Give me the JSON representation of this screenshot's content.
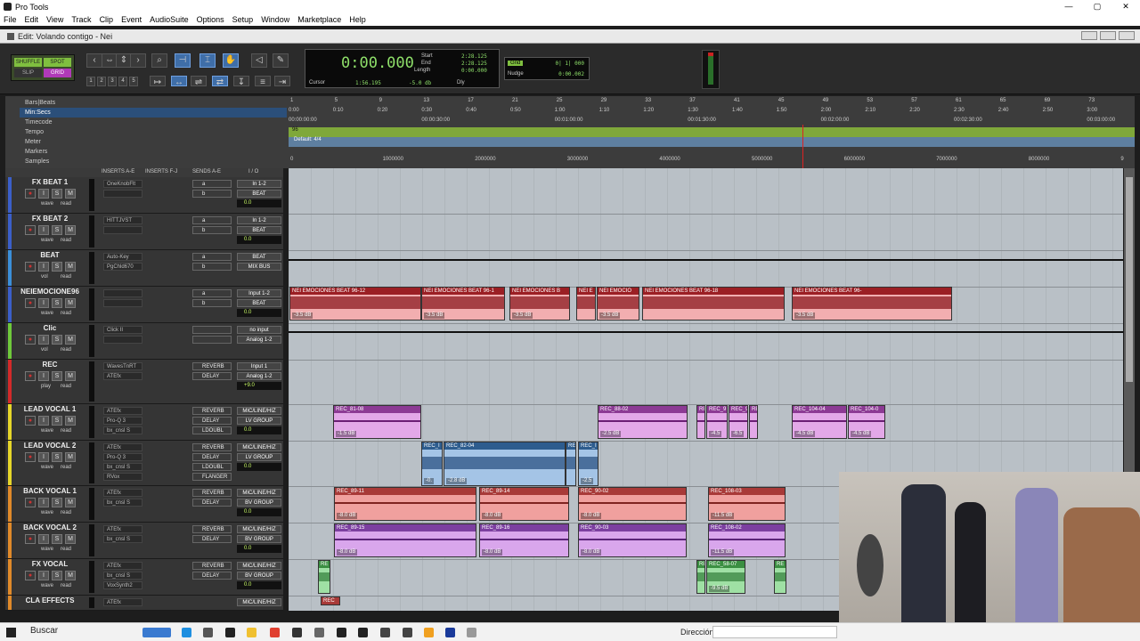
{
  "window": {
    "title": "Pro Tools",
    "minimize": "—",
    "restore": "▢",
    "close": "✕"
  },
  "menu": [
    "File",
    "Edit",
    "View",
    "Track",
    "Clip",
    "Event",
    "AudioSuite",
    "Options",
    "Setup",
    "Window",
    "Marketplace",
    "Help"
  ],
  "edit_window": {
    "title": "Edit: Volando contigo - Nei"
  },
  "modes": {
    "shuffle": "SHUFFLE",
    "spot": "SPOT",
    "slip": "SLIP",
    "grid": "GRID"
  },
  "counter": {
    "main": "0:00.000",
    "start_label": "Start",
    "start": "2:28.125",
    "end_label": "End",
    "end": "2:28.125",
    "length_label": "Length",
    "length": "0:00.000",
    "cursor_label": "Cursor",
    "cursor": "1:56.195",
    "gain": "-5.0 db",
    "dly": "Dly"
  },
  "grid": {
    "label": "Grid",
    "value": "0| 1| 000",
    "nudge_label": "Nudge",
    "nudge_value": "0:00.002"
  },
  "zoom_buttons": [
    "1",
    "2",
    "3",
    "4",
    "5"
  ],
  "rulers": {
    "rows": [
      "Bars|Beats",
      "Min:Secs",
      "Timecode",
      "Tempo",
      "Meter",
      "Markers",
      "Samples"
    ],
    "bars": [
      "1",
      "5",
      "9",
      "13",
      "17",
      "21",
      "25",
      "29",
      "33",
      "37",
      "41",
      "45",
      "49",
      "53",
      "57",
      "61",
      "65",
      "69",
      "73"
    ],
    "minsecs": [
      "0:00",
      "0:10",
      "0:20",
      "0:30",
      "0:40",
      "0:50",
      "1:00",
      "1:10",
      "1:20",
      "1:30",
      "1:40",
      "1:50",
      "2:00",
      "2:10",
      "2:20",
      "2:30",
      "2:40",
      "2:50",
      "3:00"
    ],
    "timecode": [
      "00:00:00:00",
      "00:00:30:00",
      "00:01:00:00",
      "00:01:30:00",
      "00:02:00:00",
      "00:02:30:00",
      "00:03:00:00"
    ],
    "tempo": "96",
    "meter": "Default: 4/4",
    "samples": [
      "0",
      "1000000",
      "2000000",
      "3000000",
      "4000000",
      "5000000",
      "6000000",
      "7000000",
      "8000000",
      "9"
    ]
  },
  "columns": {
    "inserts_ae": "INSERTS A-E",
    "inserts_fj": "INSERTS F-J",
    "sends_ae": "SENDS A-E",
    "io": "I / O"
  },
  "tracks": [
    {
      "name": "FX BEAT 1",
      "color": "#3b5fc9",
      "mode": "wave",
      "auto": "read",
      "inserts": [
        "OneKnobFlt",
        ""
      ],
      "sends": [
        "a",
        "b"
      ],
      "io": [
        "In 1-2",
        "BEAT"
      ],
      "vol": "0.0"
    },
    {
      "name": "FX BEAT 2",
      "color": "#3b5fc9",
      "mode": "wave",
      "auto": "read",
      "inserts": [
        "HITTJVST",
        ""
      ],
      "sends": [
        "a",
        "b"
      ],
      "io": [
        "In 1-2",
        "BEAT"
      ],
      "vol": "0.0"
    },
    {
      "name": "BEAT",
      "color": "#3b8fd9",
      "mode": "vol",
      "auto": "read",
      "inserts": [
        "Auto-Key",
        "PgChld670"
      ],
      "sends": [
        "a",
        "b"
      ],
      "io": [
        "BEAT",
        "MIX BUS"
      ],
      "vol": ""
    },
    {
      "name": "NEIEMOCIONE96",
      "color": "#3b5fc9",
      "mode": "wave",
      "auto": "read",
      "inserts": [
        "",
        ""
      ],
      "sends": [
        "a",
        "b"
      ],
      "io": [
        "Input 1-2",
        "BEAT"
      ],
      "vol": "0.0"
    },
    {
      "name": "Clic",
      "color": "#6fc93b",
      "mode": "vol",
      "auto": "read",
      "inserts": [
        "Click II",
        ""
      ],
      "sends": [
        "",
        ""
      ],
      "io": [
        "no input",
        "Analog 1-2"
      ],
      "vol": ""
    },
    {
      "name": "REC",
      "color": "#d32a2a",
      "mode": "play",
      "auto": "read",
      "inserts": [
        "WavesTnRT",
        "ATEfx"
      ],
      "sends": [
        "REVERB",
        "DELAY"
      ],
      "io": [
        "Input 1",
        "Analog 1-2"
      ],
      "vol": "+9.0"
    },
    {
      "name": "LEAD VOCAL 1",
      "color": "#e6d62a",
      "mode": "wave",
      "auto": "read",
      "inserts": [
        "ATEfx",
        "Pro-Q 3",
        "bx_cnsl S"
      ],
      "sends": [
        "REVERB",
        "DELAY",
        "LDOUBL"
      ],
      "io": [
        "MIC/LINE/HIZ",
        "LV GROUP"
      ],
      "vol": "0.0"
    },
    {
      "name": "LEAD VOCAL 2",
      "color": "#e6d62a",
      "mode": "wave",
      "auto": "read",
      "inserts": [
        "ATEfx",
        "Pro-Q 3",
        "bx_cnsl S",
        "RVox"
      ],
      "sends": [
        "REVERB",
        "DELAY",
        "LDOUBL",
        "FLANGER"
      ],
      "io": [
        "MIC/LINE/HIZ",
        "LV GROUP"
      ],
      "vol": "0.0"
    },
    {
      "name": "BACK VOCAL 1",
      "color": "#e08a2a",
      "mode": "wave",
      "auto": "read",
      "inserts": [
        "ATEfx",
        "bx_cnsl S"
      ],
      "sends": [
        "REVERB",
        "DELAY"
      ],
      "io": [
        "MIC/LINE/HIZ",
        "BV GROUP"
      ],
      "vol": "0.0"
    },
    {
      "name": "BACK VOCAL 2",
      "color": "#e08a2a",
      "mode": "wave",
      "auto": "read",
      "inserts": [
        "ATEfx",
        "bx_cnsl S"
      ],
      "sends": [
        "REVERB",
        "DELAY"
      ],
      "io": [
        "MIC/LINE/HIZ",
        "BV GROUP"
      ],
      "vol": "0.0"
    },
    {
      "name": "FX VOCAL",
      "color": "#e08a2a",
      "mode": "wave",
      "auto": "read",
      "inserts": [
        "ATEfx",
        "bx_cnsl S",
        "VoxSynth2"
      ],
      "sends": [
        "REVERB",
        "DELAY"
      ],
      "io": [
        "MIC/LINE/HIZ",
        "BV GROUP"
      ],
      "vol": "0.0"
    },
    {
      "name": "CLA EFFECTS",
      "color": "#e08a2a",
      "mode": "",
      "auto": "",
      "inserts": [
        "ATEfx"
      ],
      "sends": [],
      "io": [
        "MIC/LINE/HIZ"
      ],
      "vol": ""
    }
  ],
  "clips": {
    "beat": [
      {
        "name": "NEI EMOCIONES BEAT 96-12",
        "gain": "-3.5 dB"
      },
      {
        "name": "NEI EMOCIONES BEAT 96-1",
        "gain": "-3.5 dB"
      },
      {
        "name": "NEI EMOCIONES B",
        "gain": "-3.5 dB"
      },
      {
        "name": "NEI E",
        "gain": ""
      },
      {
        "name": "NEI EMOCIO",
        "gain": "-3.5 dB"
      },
      {
        "name": "NEI EMOCIONES BEAT 96-18",
        "gain": ""
      },
      {
        "name": "NEI EMOCIONES BEAT 96-",
        "gain": "-3.5 dB"
      }
    ],
    "lead1": [
      {
        "name": "REC_81-08",
        "gain": "-1.5 dB"
      },
      {
        "name": "REC_88-02",
        "gain": "-2.5 dB"
      },
      {
        "name": "REC",
        "gain": ""
      },
      {
        "name": "REC_9",
        "gain": "-4.5"
      },
      {
        "name": "REC_9",
        "gain": "-6.5"
      },
      {
        "name": "RE",
        "gain": ""
      },
      {
        "name": "REC_104-04",
        "gain": "-4.5 dB"
      },
      {
        "name": "REC_104-0",
        "gain": "-4.5 dB"
      }
    ],
    "lead2": [
      {
        "name": "REC_I",
        "gain": "-0."
      },
      {
        "name": "REC_82-04",
        "gain": "-2.8 dB"
      },
      {
        "name": "RE",
        "gain": ""
      },
      {
        "name": "REC_I",
        "gain": "-2.5"
      }
    ],
    "back1": [
      {
        "name": "REC_89-11",
        "gain": "-8.0 dB"
      },
      {
        "name": "REC_89-14",
        "gain": "-8.0 dB"
      },
      {
        "name": "REC_90-02",
        "gain": "-8.0 dB"
      },
      {
        "name": "REC_108-03",
        "gain": "-11.5 dB"
      }
    ],
    "back2": [
      {
        "name": "REC_89-15",
        "gain": "-8.0 dB"
      },
      {
        "name": "REC_89-16",
        "gain": "-8.0 dB"
      },
      {
        "name": "REC_90-03",
        "gain": "-8.0 dB"
      },
      {
        "name": "REC_108-02",
        "gain": "-11.5 dB"
      }
    ],
    "fx": [
      {
        "name": "RE",
        "gain": ""
      },
      {
        "name": "RE",
        "gain": ""
      },
      {
        "name": "REC_58-07",
        "gain": "-9.5 dB"
      },
      {
        "name": "RE",
        "gain": ""
      }
    ],
    "cla": [
      {
        "name": "REC",
        "gain": ""
      }
    ]
  },
  "taskbar": {
    "search": "Buscar",
    "direccion": "Dirección"
  }
}
